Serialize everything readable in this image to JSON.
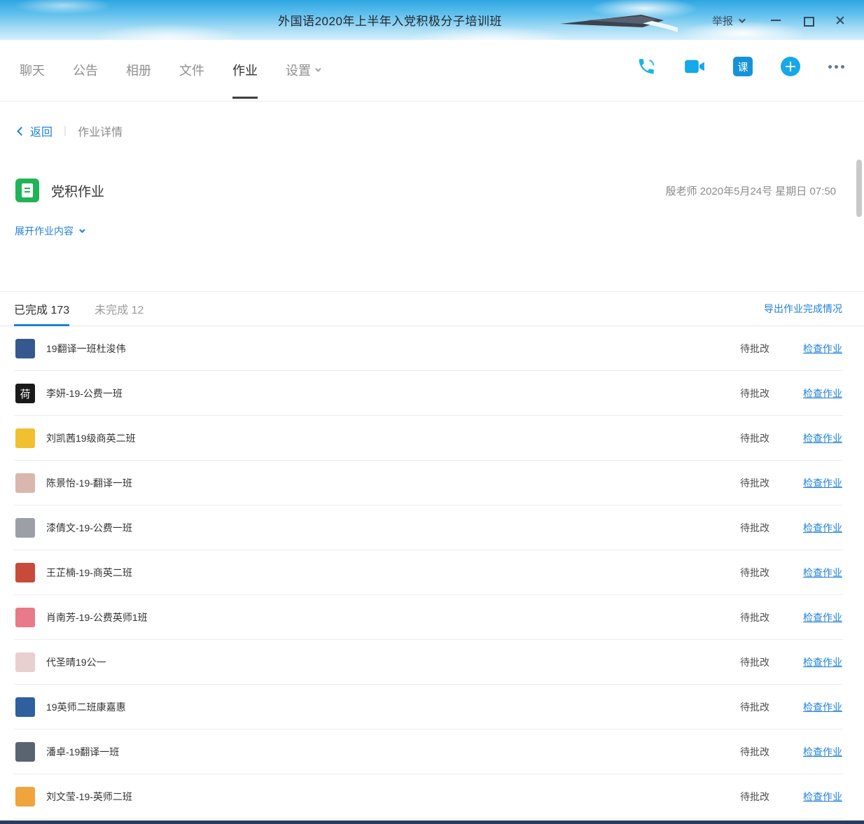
{
  "window": {
    "title": "外国语2020年上半年入党积极分子培训班",
    "report_label": "举报",
    "controls": [
      "minimize",
      "maximize",
      "close"
    ]
  },
  "nav": {
    "tabs": [
      {
        "label": "聊天"
      },
      {
        "label": "公告"
      },
      {
        "label": "相册"
      },
      {
        "label": "文件"
      },
      {
        "label": "作业"
      },
      {
        "label": "设置"
      }
    ],
    "active_tab": "作业",
    "icons": [
      "voice-call-icon",
      "video-call-icon",
      "course-icon",
      "add-icon",
      "more-icon"
    ],
    "course_badge": "课"
  },
  "breadcrumb": {
    "back": "返回",
    "current": "作业详情"
  },
  "homework": {
    "title": "党积作业",
    "meta": "殷老师 2020年5月24号 星期日 07:50",
    "expand": "展开作业内容"
  },
  "filter_tabs": {
    "completed": "已完成 173",
    "incomplete": "未完成 12",
    "export": "导出作业完成情况"
  },
  "list": {
    "status": "待批改",
    "action": "检查作业",
    "students": [
      {
        "name": "19翻译一班杜浚伟",
        "avatar_color": "#35598f",
        "avatar_text": ""
      },
      {
        "name": "李妍-19-公费一班",
        "avatar_color": "#1a1a1a",
        "avatar_text": "荷"
      },
      {
        "name": "刘凯茜19级商英二班",
        "avatar_color": "#f0c030",
        "avatar_text": ""
      },
      {
        "name": "陈景怡-19-翻译一班",
        "avatar_color": "#d9b7ae",
        "avatar_text": ""
      },
      {
        "name": "漆倩文-19-公费一班",
        "avatar_color": "#9aa0a6",
        "avatar_text": ""
      },
      {
        "name": "王芷楠-19-商英二班",
        "avatar_color": "#c84a3a",
        "avatar_text": ""
      },
      {
        "name": "肖南芳-19-公费英师1班",
        "avatar_color": "#e87a8a",
        "avatar_text": ""
      },
      {
        "name": "代圣晴19公一",
        "avatar_color": "#e8cfd0",
        "avatar_text": ""
      },
      {
        "name": "19英师二班康嘉惠",
        "avatar_color": "#2f5f9e",
        "avatar_text": ""
      },
      {
        "name": "潘卓-19翻译一班",
        "avatar_color": "#5a6470",
        "avatar_text": ""
      },
      {
        "name": "刘文莹-19-英师二班",
        "avatar_color": "#f0a43c",
        "avatar_text": ""
      }
    ]
  },
  "colors": {
    "accent_blue": "#1f80d8",
    "homework_icon_green": "#21b358",
    "nav_icon_blue": "#16a8e8",
    "phone_teal": "#1bb5e5",
    "active_nav_underline": "#3f3f3f",
    "titlebar_sky": "#2ea6e2"
  }
}
